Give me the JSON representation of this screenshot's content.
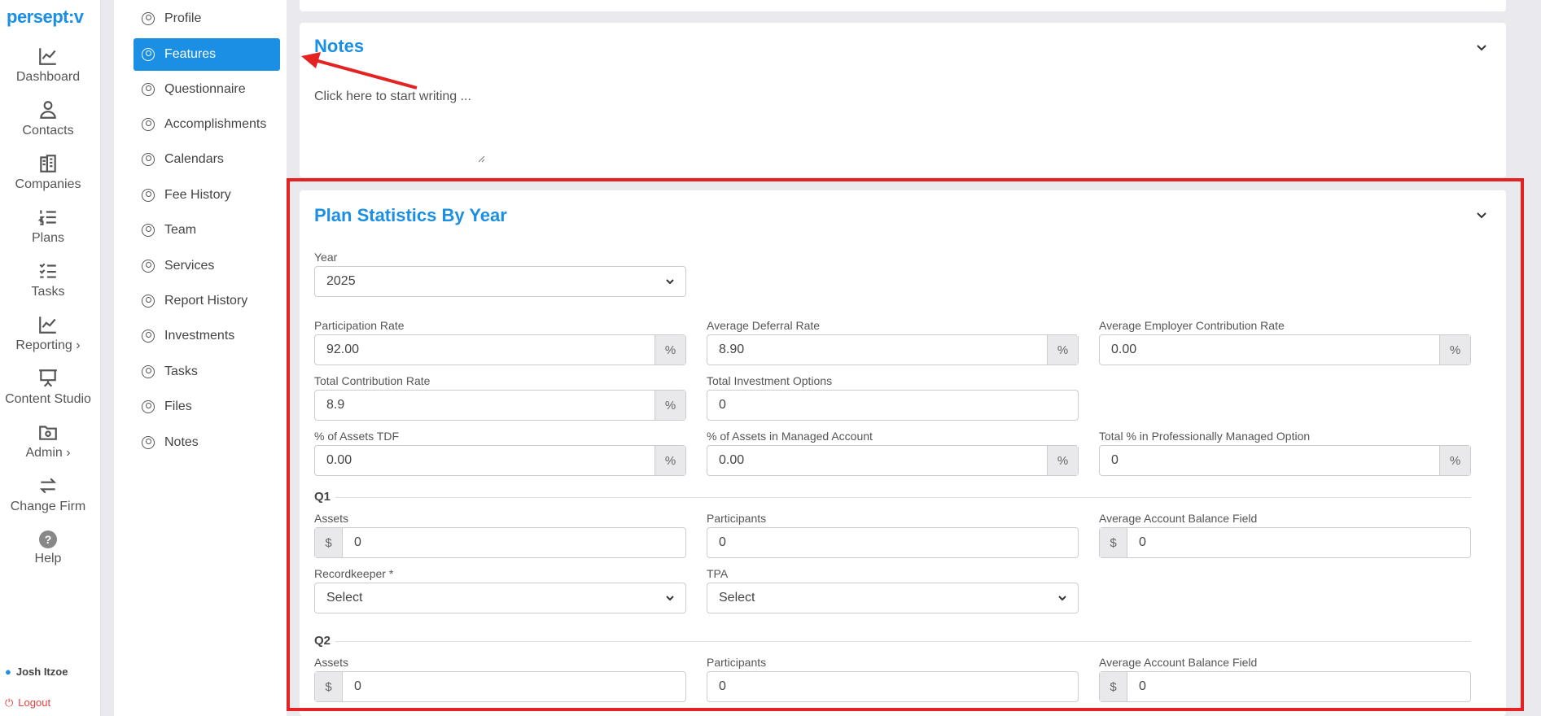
{
  "app": {
    "logo": "persept:v"
  },
  "main_nav": [
    {
      "label": "Dashboard",
      "icon": "chart-line-icon"
    },
    {
      "label": "Contacts",
      "icon": "person-icon"
    },
    {
      "label": "Companies",
      "icon": "building-icon"
    },
    {
      "label": "Plans",
      "icon": "numbered-list-icon"
    },
    {
      "label": "Tasks",
      "icon": "checklist-icon"
    },
    {
      "label": "Reporting ›",
      "icon": "chart-line-icon"
    },
    {
      "label": "Content Studio",
      "icon": "presentation-icon"
    },
    {
      "label": "Admin ›",
      "icon": "folder-gear-icon"
    },
    {
      "label": "Change Firm",
      "icon": "swap-arrows-icon"
    },
    {
      "label": "Help",
      "icon": "question-icon"
    }
  ],
  "user": {
    "name": "Josh Itzoe",
    "logout": "Logout"
  },
  "sub_nav": {
    "items": [
      "Profile",
      "Features",
      "Questionnaire",
      "Accomplishments",
      "Calendars",
      "Fee History",
      "Team",
      "Services",
      "Report History",
      "Investments",
      "Tasks",
      "Files",
      "Notes"
    ],
    "active": "Features"
  },
  "notes": {
    "title": "Notes",
    "placeholder": "Click here to start writing ..."
  },
  "plan_stats": {
    "title": "Plan Statistics By Year",
    "year_label": "Year",
    "year_value": "2025",
    "participation_rate": {
      "label": "Participation Rate",
      "value": "92.00",
      "unit": "%"
    },
    "avg_deferral_rate": {
      "label": "Average Deferral Rate",
      "value": "8.90",
      "unit": "%"
    },
    "avg_employer_rate": {
      "label": "Average Employer Contribution Rate",
      "value": "0.00",
      "unit": "%"
    },
    "total_contribution_rate": {
      "label": "Total Contribution Rate",
      "value": "8.9",
      "unit": "%"
    },
    "total_investment_options": {
      "label": "Total Investment Options",
      "value": "0"
    },
    "assets_tdf": {
      "label": "% of Assets TDF",
      "value": "0.00",
      "unit": "%"
    },
    "assets_managed": {
      "label": "% of Assets in Managed Account",
      "value": "0.00",
      "unit": "%"
    },
    "total_prof_managed": {
      "label": "Total % in Professionally Managed Option",
      "value": "0",
      "unit": "%"
    },
    "q1": {
      "header": "Q1",
      "assets_label": "Assets",
      "assets_prefix": "$",
      "assets_value": "0",
      "participants_label": "Participants",
      "participants_value": "0",
      "avg_balance_label": "Average Account Balance Field",
      "avg_balance_prefix": "$",
      "avg_balance_value": "0",
      "recordkeeper_label": "Recordkeeper *",
      "recordkeeper_value": "Select",
      "tpa_label": "TPA",
      "tpa_value": "Select"
    },
    "q2": {
      "header": "Q2",
      "assets_label": "Assets",
      "assets_prefix": "$",
      "assets_value": "0",
      "participants_label": "Participants",
      "participants_value": "0",
      "avg_balance_label": "Average Account Balance Field",
      "avg_balance_prefix": "$",
      "avg_balance_value": "0"
    }
  },
  "colors": {
    "accent": "#1a8fe3",
    "annotation": "#e52222"
  }
}
